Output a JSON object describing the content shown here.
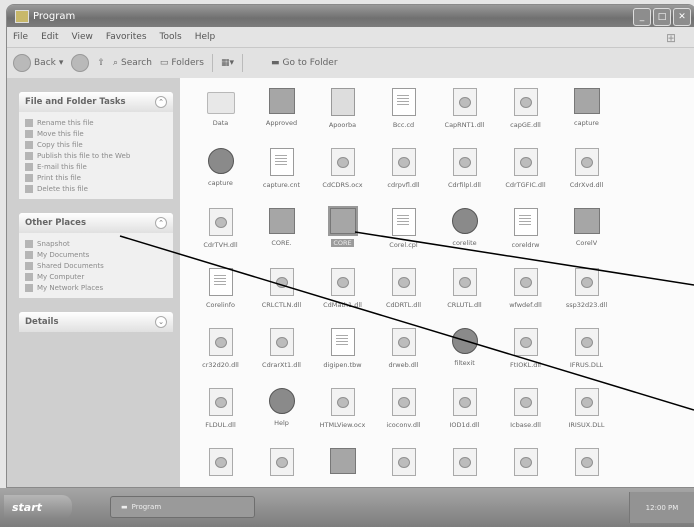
{
  "window": {
    "title": "Program"
  },
  "menu": [
    "File",
    "Edit",
    "View",
    "Favorites",
    "Tools",
    "Help"
  ],
  "toolbar": {
    "back": "Back",
    "search": "Search",
    "folders": "Folders",
    "view_icon": "view-icon",
    "goto": "Go to Folder"
  },
  "left_panels": [
    {
      "title": "File and Folder Tasks",
      "items": [
        "Rename this file",
        "Move this file",
        "Copy this file",
        "Publish this file to the Web",
        "E-mail this file",
        "Print this file",
        "Delete this file"
      ]
    },
    {
      "title": "Other Places",
      "items": [
        "Snapshot",
        "My Documents",
        "Shared Documents",
        "My Computer",
        "My Network Places"
      ]
    },
    {
      "title": "Details",
      "items": []
    }
  ],
  "files": [
    {
      "name": "Data",
      "type": "folder"
    },
    {
      "name": "Approved",
      "type": "exe"
    },
    {
      "name": "Apoorba",
      "type": "net"
    },
    {
      "name": "Bcc.cd",
      "type": "doc"
    },
    {
      "name": "CapRNT1.dll",
      "type": "dll"
    },
    {
      "name": "capGE.dll",
      "type": "dll"
    },
    {
      "name": "capture",
      "type": "exe"
    },
    {
      "name": "capture",
      "type": "round"
    },
    {
      "name": "capture.cnt",
      "type": "doc"
    },
    {
      "name": "CdCDRS.ocx",
      "type": "dll"
    },
    {
      "name": "cdrpvfl.dll",
      "type": "dll"
    },
    {
      "name": "Cdrfilpl.dll",
      "type": "dll"
    },
    {
      "name": "CdrTGFIC.dll",
      "type": "dll"
    },
    {
      "name": "CdrXvd.dll",
      "type": "dll"
    },
    {
      "name": "CdrTVH.dll",
      "type": "dll"
    },
    {
      "name": "CORE.",
      "type": "exe"
    },
    {
      "name": "CORE",
      "type": "exe",
      "selected": true
    },
    {
      "name": "Corel.cpl",
      "type": "doc"
    },
    {
      "name": "corelite",
      "type": "round"
    },
    {
      "name": "coreldrw",
      "type": "doc"
    },
    {
      "name": "CorelV",
      "type": "exe"
    },
    {
      "name": "Corelinfo",
      "type": "doc"
    },
    {
      "name": "CRLCTLN.dll",
      "type": "dll"
    },
    {
      "name": "CdMath1.dll",
      "type": "dll"
    },
    {
      "name": "CdDRTL.dll",
      "type": "dll"
    },
    {
      "name": "CRLUTL.dll",
      "type": "dll"
    },
    {
      "name": "wfwdef.dll",
      "type": "dll"
    },
    {
      "name": "ssp32d23.dll",
      "type": "dll"
    },
    {
      "name": "cr32d20.dll",
      "type": "dll"
    },
    {
      "name": "CdrarXt1.dll",
      "type": "dll"
    },
    {
      "name": "digipen.tbw",
      "type": "doc"
    },
    {
      "name": "drweb.dll",
      "type": "dll"
    },
    {
      "name": "filtexit",
      "type": "round"
    },
    {
      "name": "FtIOKL.dll",
      "type": "dll"
    },
    {
      "name": "IFRUS.DLL",
      "type": "dll"
    },
    {
      "name": "FLDUL.dll",
      "type": "dll"
    },
    {
      "name": "Help",
      "type": "round"
    },
    {
      "name": "HTMLView.ocx",
      "type": "dll"
    },
    {
      "name": "icoconv.dll",
      "type": "dll"
    },
    {
      "name": "IOD1d.dll",
      "type": "dll"
    },
    {
      "name": "Icbase.dll",
      "type": "dll"
    },
    {
      "name": "IRISUX.DLL",
      "type": "dll"
    },
    {
      "name": "",
      "type": "dll"
    },
    {
      "name": "",
      "type": "dll"
    },
    {
      "name": "",
      "type": "exe"
    },
    {
      "name": "",
      "type": "dll"
    },
    {
      "name": "",
      "type": "dll"
    },
    {
      "name": "",
      "type": "dll"
    },
    {
      "name": "",
      "type": "dll"
    }
  ],
  "taskbar": {
    "start": "start",
    "task": "Program",
    "clock": "12:00 PM"
  }
}
